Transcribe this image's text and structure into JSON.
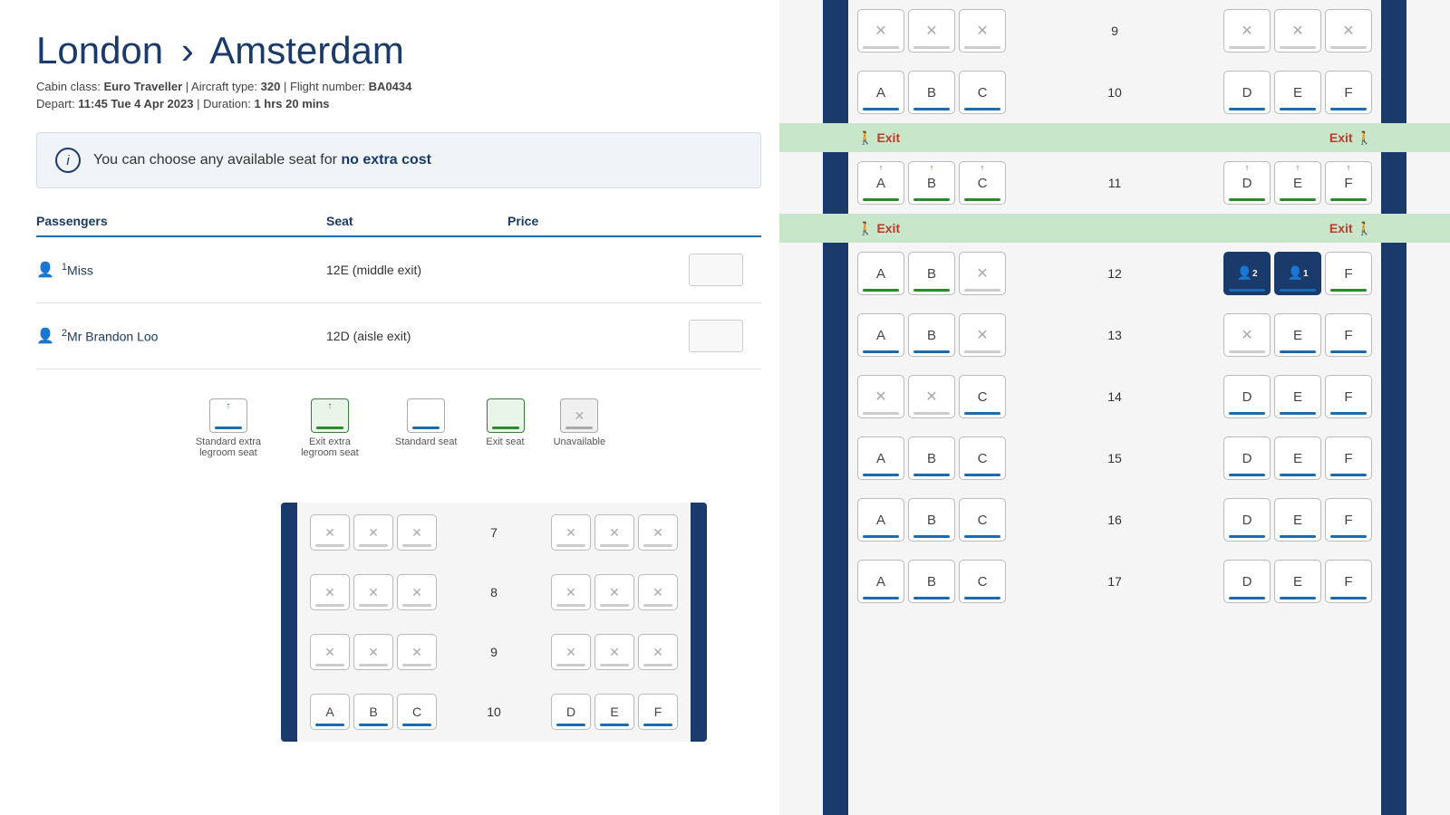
{
  "header": {
    "title_from": "London",
    "title_to": "Amsterdam",
    "chevron": "›",
    "cabin_label": "Cabin class:",
    "cabin_value": "Euro Traveller",
    "aircraft_label": "Aircraft type:",
    "aircraft_value": "320",
    "flight_label": "Flight number:",
    "flight_value": "BA0434",
    "depart_label": "Depart:",
    "depart_value": "11:45 Tue 4 Apr 2023",
    "duration_label": "Duration:",
    "duration_value": "1 hrs 20 mins"
  },
  "banner": {
    "text_normal": "You can choose any available seat for",
    "text_bold": "no extra cost",
    "icon_label": "i"
  },
  "table": {
    "col_passengers": "Passengers",
    "col_seat": "Seat",
    "col_price": "Price",
    "rows": [
      {
        "number": "1",
        "name": "Miss",
        "seat": "12E  (middle exit)",
        "price": ""
      },
      {
        "number": "2",
        "name": "Mr Brandon Loo",
        "seat": "12D  (aisle exit)",
        "price": ""
      }
    ]
  },
  "legend": {
    "items": [
      {
        "type": "extra-legroom",
        "label": "Standard extra\nlegroom seat",
        "bar": "blue",
        "arrow": true,
        "arrow_color": "blue"
      },
      {
        "type": "exit-extra",
        "label": "Exit extra\nlegroom seat",
        "bar": "green",
        "arrow": true,
        "arrow_color": "green"
      },
      {
        "type": "standard",
        "label": "Standard seat",
        "bar": "blue",
        "arrow": false
      },
      {
        "type": "exit",
        "label": "Exit seat",
        "bar": "green",
        "arrow": false
      },
      {
        "type": "unavailable",
        "label": "Unavailable",
        "bar": "gray",
        "arrow": false,
        "x": true
      }
    ]
  },
  "seat_map": {
    "rows": [
      {
        "number": "9",
        "left": [
          {
            "label": "×",
            "type": "unavailable"
          },
          {
            "label": "×",
            "type": "unavailable"
          },
          {
            "label": "×",
            "type": "unavailable"
          }
        ],
        "right": [
          {
            "label": "×",
            "type": "unavailable"
          },
          {
            "label": "×",
            "type": "unavailable"
          },
          {
            "label": "×",
            "type": "unavailable"
          }
        ]
      },
      {
        "number": "10",
        "left": [
          {
            "label": "A",
            "type": "available"
          },
          {
            "label": "B",
            "type": "available"
          },
          {
            "label": "C",
            "type": "available"
          }
        ],
        "right": [
          {
            "label": "D",
            "type": "available"
          },
          {
            "label": "E",
            "type": "available"
          },
          {
            "label": "F",
            "type": "available"
          }
        ]
      },
      {
        "type": "exit",
        "left_label": "Exit",
        "right_label": "Exit"
      },
      {
        "number": "11",
        "left": [
          {
            "label": "A",
            "type": "exit-extra",
            "arrow": true
          },
          {
            "label": "B",
            "type": "exit-extra",
            "arrow": true
          },
          {
            "label": "C",
            "type": "exit-extra",
            "arrow": true
          }
        ],
        "right": [
          {
            "label": "D",
            "type": "exit-extra",
            "arrow": true
          },
          {
            "label": "E",
            "type": "exit-extra",
            "arrow": true
          },
          {
            "label": "F",
            "type": "exit-extra",
            "arrow": true
          }
        ]
      },
      {
        "type": "exit",
        "left_label": "Exit",
        "right_label": "Exit"
      },
      {
        "number": "12",
        "left": [
          {
            "label": "A",
            "type": "exit-extra"
          },
          {
            "label": "B",
            "type": "exit-extra"
          },
          {
            "label": "×",
            "type": "unavailable"
          }
        ],
        "right": [
          {
            "label": "2",
            "type": "selected-2"
          },
          {
            "label": "1",
            "type": "selected-1"
          },
          {
            "label": "F",
            "type": "exit-extra"
          }
        ]
      },
      {
        "number": "13",
        "left": [
          {
            "label": "A",
            "type": "available"
          },
          {
            "label": "B",
            "type": "available"
          },
          {
            "label": "×",
            "type": "unavailable"
          }
        ],
        "right": [
          {
            "label": "×",
            "type": "unavailable"
          },
          {
            "label": "E",
            "type": "available"
          },
          {
            "label": "F",
            "type": "available"
          }
        ]
      },
      {
        "number": "14",
        "left": [
          {
            "label": "×",
            "type": "unavailable"
          },
          {
            "label": "×",
            "type": "unavailable"
          },
          {
            "label": "C",
            "type": "available"
          }
        ],
        "right": [
          {
            "label": "D",
            "type": "available"
          },
          {
            "label": "E",
            "type": "available"
          },
          {
            "label": "F",
            "type": "available"
          }
        ]
      },
      {
        "number": "15",
        "left": [
          {
            "label": "A",
            "type": "available"
          },
          {
            "label": "B",
            "type": "available"
          },
          {
            "label": "C",
            "type": "available"
          }
        ],
        "right": [
          {
            "label": "D",
            "type": "available"
          },
          {
            "label": "E",
            "type": "available"
          },
          {
            "label": "F",
            "type": "available"
          }
        ]
      },
      {
        "number": "16",
        "left": [
          {
            "label": "A",
            "type": "available"
          },
          {
            "label": "B",
            "type": "available"
          },
          {
            "label": "C",
            "type": "available"
          }
        ],
        "right": [
          {
            "label": "D",
            "type": "available"
          },
          {
            "label": "E",
            "type": "available"
          },
          {
            "label": "F",
            "type": "available"
          }
        ]
      },
      {
        "number": "17",
        "left": [
          {
            "label": "A",
            "type": "available"
          },
          {
            "label": "B",
            "type": "available"
          },
          {
            "label": "C",
            "type": "available"
          }
        ],
        "right": [
          {
            "label": "D",
            "type": "available"
          },
          {
            "label": "E",
            "type": "available"
          },
          {
            "label": "F",
            "type": "available"
          }
        ]
      }
    ],
    "bottom_partial_rows": [
      {
        "number": "7",
        "left": [
          {
            "label": "×",
            "type": "unavailable"
          },
          {
            "label": "×",
            "type": "unavailable"
          },
          {
            "label": "×",
            "type": "unavailable"
          }
        ],
        "right": [
          {
            "label": "×",
            "type": "unavailable"
          },
          {
            "label": "×",
            "type": "unavailable"
          },
          {
            "label": "×",
            "type": "unavailable"
          }
        ]
      },
      {
        "number": "8",
        "left": [
          {
            "label": "×",
            "type": "unavailable"
          },
          {
            "label": "×",
            "type": "unavailable"
          },
          {
            "label": "×",
            "type": "unavailable"
          }
        ],
        "right": [
          {
            "label": "×",
            "type": "unavailable"
          },
          {
            "label": "×",
            "type": "unavailable"
          },
          {
            "label": "×",
            "type": "unavailable"
          }
        ]
      },
      {
        "number": "9",
        "left": [
          {
            "label": "×",
            "type": "unavailable"
          },
          {
            "label": "×",
            "type": "unavailable"
          },
          {
            "label": "×",
            "type": "unavailable"
          }
        ],
        "right": [
          {
            "label": "×",
            "type": "unavailable"
          },
          {
            "label": "×",
            "type": "unavailable"
          },
          {
            "label": "×",
            "type": "unavailable"
          }
        ]
      },
      {
        "number": "10",
        "left": [
          {
            "label": "A",
            "type": "available"
          },
          {
            "label": "B",
            "type": "available"
          },
          {
            "label": "C",
            "type": "available"
          }
        ],
        "right": [
          {
            "label": "D",
            "type": "available"
          },
          {
            "label": "E",
            "type": "available"
          },
          {
            "label": "F",
            "type": "available"
          }
        ]
      }
    ]
  },
  "colors": {
    "brand_dark": "#1a3a6b",
    "brand_blue": "#1a6bb0",
    "exit_green": "#2a8a2a",
    "exit_bg": "#c8e6c9",
    "exit_red": "#c0392b",
    "unavailable_gray": "#aaa"
  }
}
